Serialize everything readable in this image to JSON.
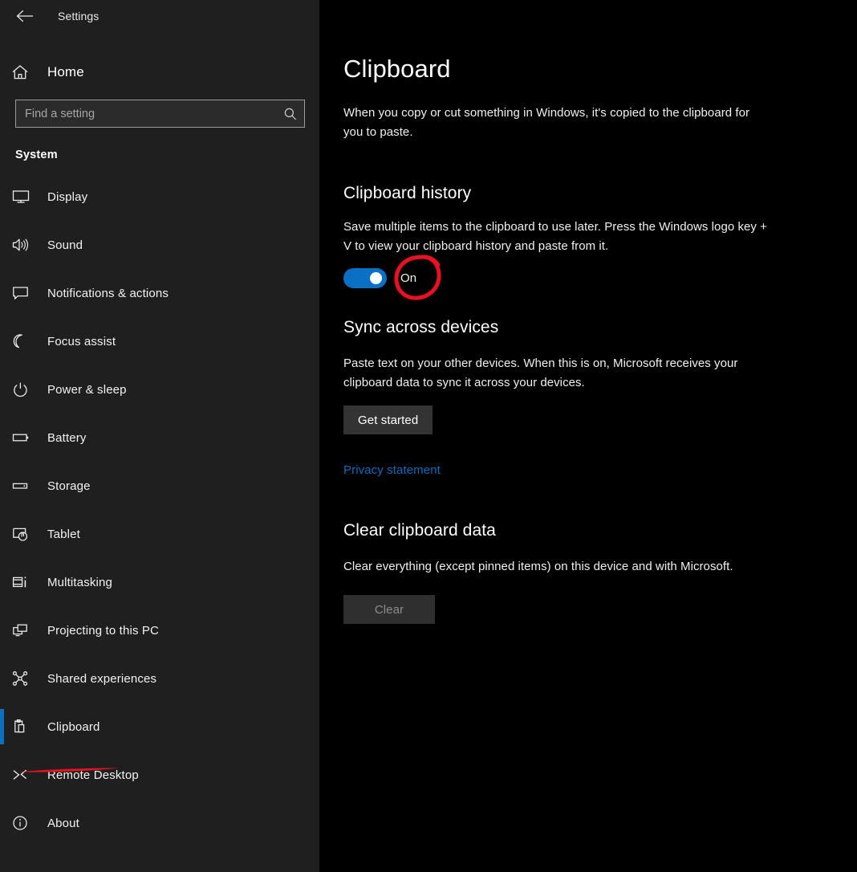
{
  "titlebar": {
    "back_icon": "back-arrow-icon",
    "app_title": "Settings"
  },
  "sidebar": {
    "home": {
      "label": "Home",
      "icon": "home-icon"
    },
    "search": {
      "placeholder": "Find a setting",
      "value": "",
      "icon": "search-icon"
    },
    "group_title": "System",
    "items": [
      {
        "label": "Display",
        "icon": "monitor-icon",
        "selected": false
      },
      {
        "label": "Sound",
        "icon": "speaker-icon",
        "selected": false
      },
      {
        "label": "Notifications & actions",
        "icon": "notification-balloon-icon",
        "selected": false
      },
      {
        "label": "Focus assist",
        "icon": "moon-icon",
        "selected": false
      },
      {
        "label": "Power & sleep",
        "icon": "power-icon",
        "selected": false
      },
      {
        "label": "Battery",
        "icon": "battery-icon",
        "selected": false
      },
      {
        "label": "Storage",
        "icon": "storage-drive-icon",
        "selected": false
      },
      {
        "label": "Tablet",
        "icon": "tablet-touch-icon",
        "selected": false
      },
      {
        "label": "Multitasking",
        "icon": "multitasking-icon",
        "selected": false
      },
      {
        "label": "Projecting to this PC",
        "icon": "projecting-screens-icon",
        "selected": false
      },
      {
        "label": "Shared experiences",
        "icon": "shared-nodes-icon",
        "selected": false
      },
      {
        "label": "Clipboard",
        "icon": "clipboard-icon",
        "selected": true
      },
      {
        "label": "Remote Desktop",
        "icon": "remote-desktop-arrows-icon",
        "selected": false
      },
      {
        "label": "About",
        "icon": "info-circle-icon",
        "selected": false
      }
    ]
  },
  "main": {
    "page_title": "Clipboard",
    "intro_text": "When you copy or cut something in Windows, it's copied to the clipboard for you to paste.",
    "sections": {
      "history": {
        "heading": "Clipboard history",
        "description": "Save multiple items to the clipboard to use later. Press the Windows logo key + V to view your clipboard history and paste from it.",
        "toggle_state": "On",
        "toggle_on": true
      },
      "sync": {
        "heading": "Sync across devices",
        "description": "Paste text on your other devices. When this is on, Microsoft receives your clipboard data to sync it across your devices.",
        "button_label": "Get started",
        "link_label": "Privacy statement"
      },
      "clear": {
        "heading": "Clear clipboard data",
        "description": "Clear everything (except pinned items) on this device and with Microsoft.",
        "button_label": "Clear",
        "button_disabled": true
      }
    }
  },
  "annotations": {
    "color": "#e81123",
    "underline_target": "Clipboard",
    "circle_target": "On"
  },
  "colors": {
    "sidebar_bg": "#1f1f1f",
    "content_bg": "#000000",
    "accent": "#0a70c4",
    "link": "#0a6cbb",
    "annotation_red": "#e81123",
    "button_bg": "#333333",
    "disabled_text": "#8c8c8c"
  }
}
